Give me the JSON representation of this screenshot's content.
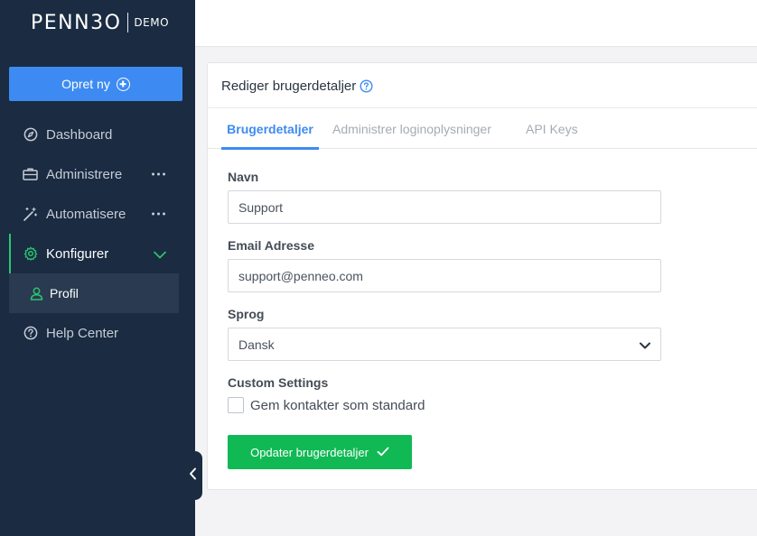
{
  "brand": {
    "logo_text": "PENN3O",
    "env_label": "DEMO"
  },
  "sidebar": {
    "create_label": "Opret ny",
    "items": [
      {
        "label": "Dashboard"
      },
      {
        "label": "Administrere"
      },
      {
        "label": "Automatisere"
      },
      {
        "label": "Konfigurer"
      },
      {
        "label": "Help Center"
      }
    ],
    "sub_items": [
      {
        "label": "Profil"
      }
    ]
  },
  "panel": {
    "title": "Rediger brugerdetaljer",
    "tabs": [
      {
        "label": "Brugerdetaljer"
      },
      {
        "label": "Administrer loginoplysninger"
      },
      {
        "label": "API Keys"
      }
    ]
  },
  "form": {
    "name_label": "Navn",
    "name_value": "Support",
    "email_label": "Email Adresse",
    "email_value": "support@penneo.com",
    "language_label": "Sprog",
    "language_value": "Dansk",
    "custom_label": "Custom Settings",
    "checkbox_label": "Gem kontakter som standard",
    "submit_label": "Opdater brugerdetaljer"
  },
  "colors": {
    "sidebar_bg": "#1a2b42",
    "primary_blue": "#3d8bf2",
    "accent_green": "#2ac56f",
    "button_green": "#10b954"
  }
}
